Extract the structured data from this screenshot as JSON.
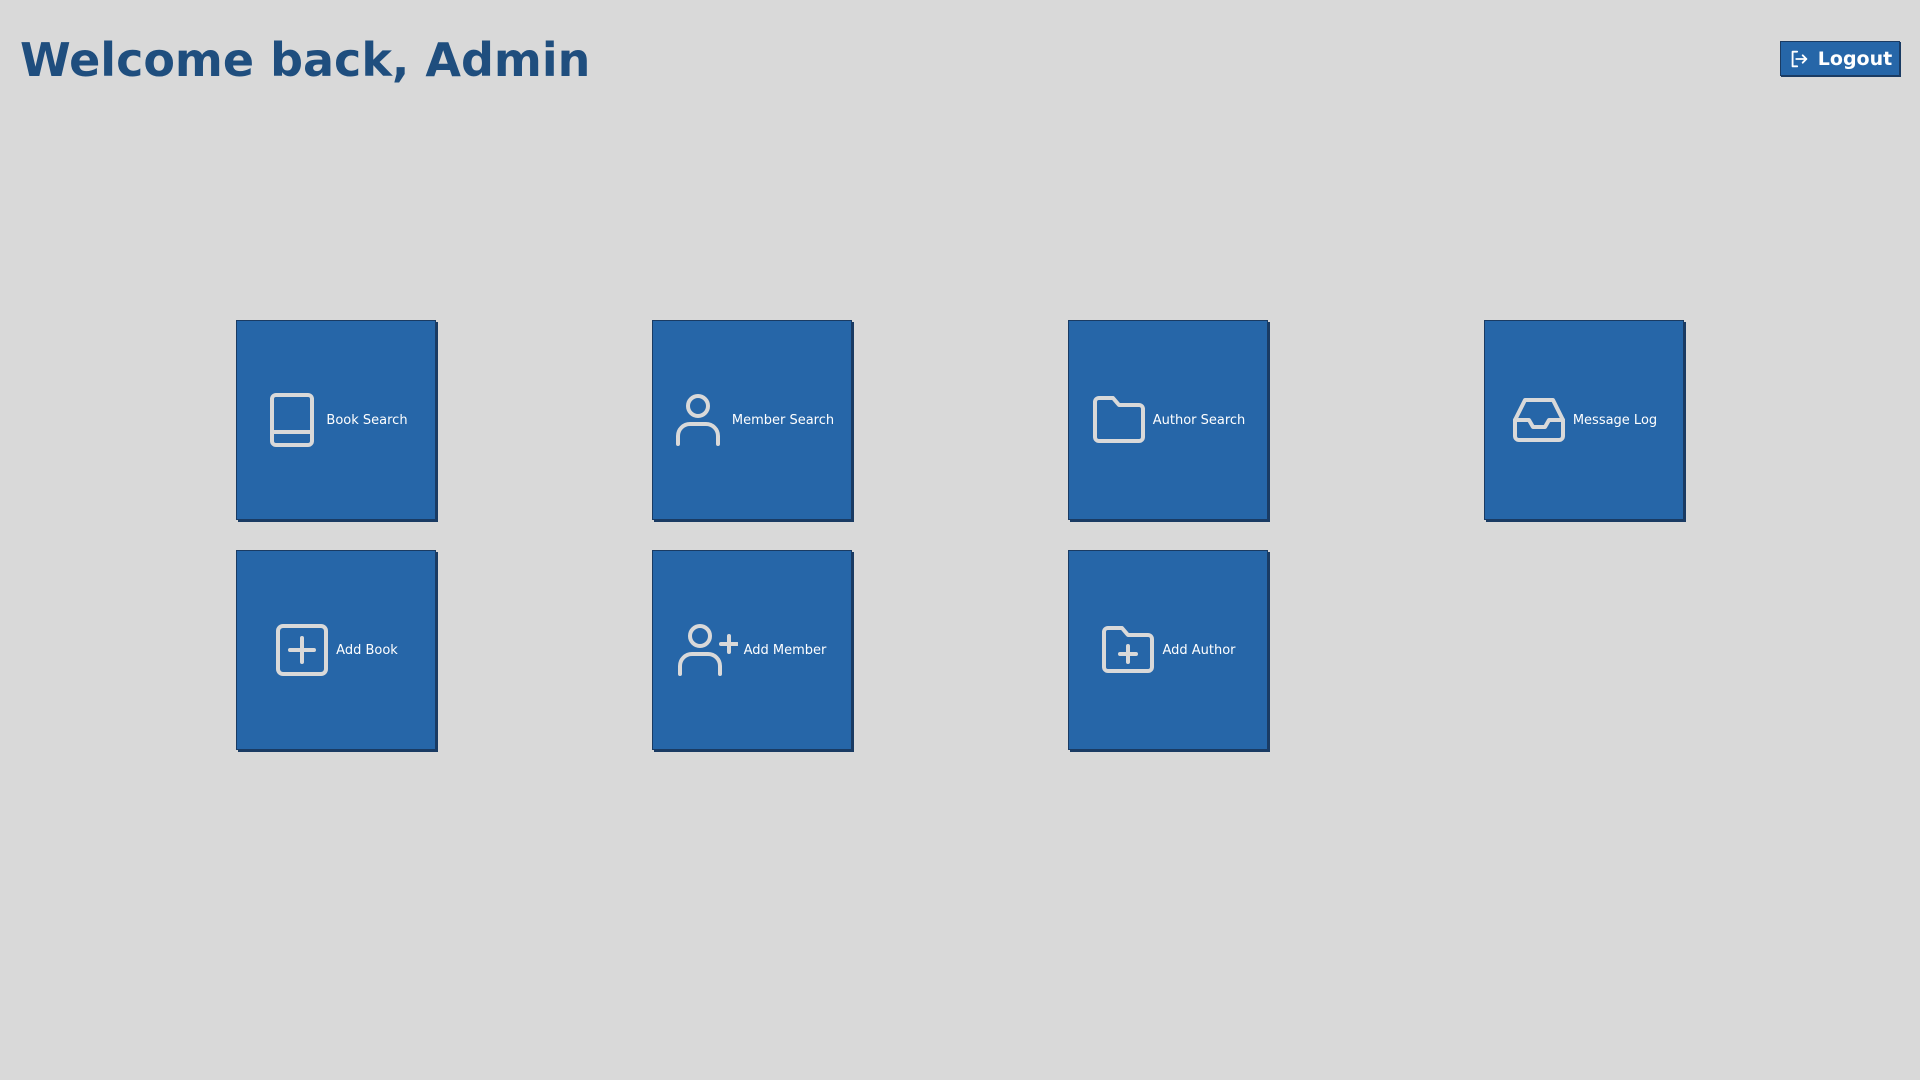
{
  "header": {
    "welcome_text": "Welcome back, Admin",
    "logout_label": "Logout"
  },
  "tiles": [
    {
      "label": "Book Search",
      "icon": "book-icon"
    },
    {
      "label": "Member Search",
      "icon": "user-icon"
    },
    {
      "label": "Author Search",
      "icon": "folder-icon"
    },
    {
      "label": "Message Log",
      "icon": "inbox-icon"
    },
    {
      "label": "Add Book",
      "icon": "plus-square-icon"
    },
    {
      "label": "Add Member",
      "icon": "user-plus-icon"
    },
    {
      "label": "Add Author",
      "icon": "folder-plus-icon"
    }
  ],
  "colors": {
    "background": "#d9d9d9",
    "tile": "#2666a8",
    "tile_border": "#1a3b63",
    "title": "#1f4e7e",
    "icon_stroke": "#d9d9d9",
    "label": "#ffffff"
  }
}
